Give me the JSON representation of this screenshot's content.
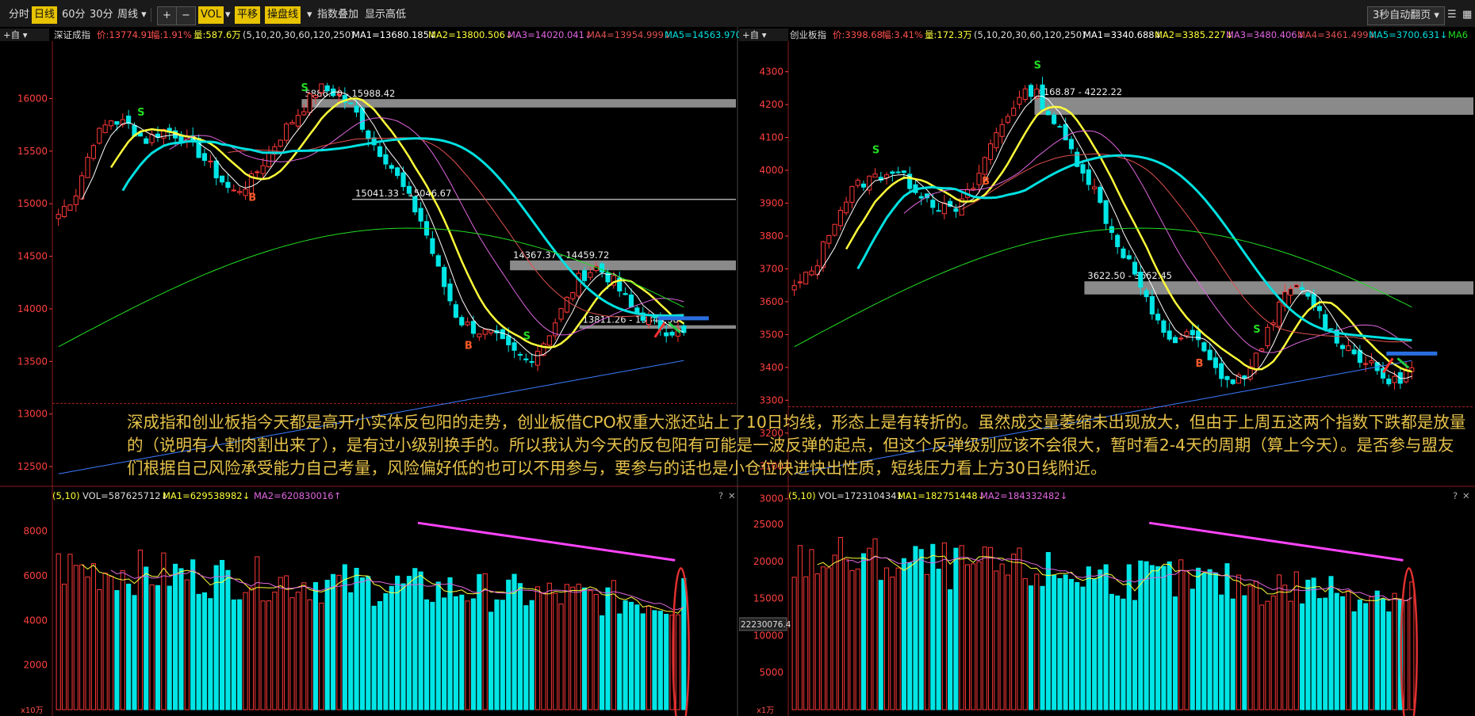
{
  "toolbar": {
    "items": [
      "分时",
      "日线",
      "60分",
      "30分",
      "周线",
      "VOL",
      "平移",
      "操盘线",
      "指数叠加",
      "显示高低"
    ],
    "right_label": "3秒自动翻页",
    "active_period": "日线"
  },
  "colors": {
    "up": "#ff3838",
    "down": "#00e5e5",
    "ma5": "#ffffff",
    "ma10": "#ffff3a",
    "ma20": "#e066e0",
    "ma30": "#e05050",
    "ma60": "#00e0e0",
    "ma120": "#22dd22",
    "ma250": "#3b7bff",
    "annotation": "#e6c24a"
  },
  "charts": [
    {
      "header": {
        "name": "深证成指",
        "price": "价:13774.91",
        "amp": "幅:1.91%",
        "amount": "量:587.6万",
        "params": "(5,10,20,30,60,120,250)",
        "ma_values": [
          "MA1=13680.185↓",
          "MA2=13800.506↓",
          "MA3=14020.041↓",
          "MA4=13954.999↓",
          "MA5=14563.970"
        ]
      },
      "y_ticks": [
        "16000",
        "15500",
        "15000",
        "14500",
        "14000",
        "13500",
        "13000",
        "12500"
      ],
      "ymin": 12350,
      "ymax": 16380,
      "zones": [
        {
          "label": "5886.70 - 15988.42",
          "low": 15915,
          "high": 15995
        },
        {
          "label": "15041.33 - 15046.67",
          "low": 15041,
          "high": 15047
        },
        {
          "label": "14367.37 - 14459.72",
          "low": 14367,
          "high": 14460
        },
        {
          "label": "13811.26 - 13843.58",
          "low": 13811,
          "high": 13844
        }
      ],
      "vol_header": {
        "params": "(5,10)",
        "vol": "VOL=587625712↓",
        "ma1": "MA1=629538982↓",
        "ma2": "MA2=620830016↑"
      },
      "vol_ticks": [
        "8000",
        "6000",
        "4000",
        "2000"
      ],
      "vol_unit": "x10万",
      "vol_max": 9300,
      "end_price": 13774.91,
      "low_price": 13100,
      "end_vol": 5876
    },
    {
      "header": {
        "name": "创业板指",
        "price": "价:3398.68",
        "amp": "幅:3.41%",
        "amount": "量:172.3万",
        "params": "(5,10,20,30,60,120,250)",
        "ma_values": [
          "MA1=3340.688↓",
          "MA2=3385.227↓",
          "MA3=3480.406↓",
          "MA4=3461.499↓",
          "MA5=3700.631↓",
          "MA6"
        ]
      },
      "y_ticks": [
        "4300",
        "4200",
        "4100",
        "4000",
        "3900",
        "3800",
        "3700",
        "3600",
        "3500",
        "3400",
        "3300",
        "3200",
        "3100",
        "3000"
      ],
      "ymin": 3050,
      "ymax": 4340,
      "zones": [
        {
          "label": "4168.87 - 4222.22",
          "low": 4169,
          "high": 4222
        },
        {
          "label": "3622.50 - 3662.45",
          "low": 3622,
          "high": 3662
        }
      ],
      "vol_header": {
        "params": "(5,10)",
        "vol": "VOL=1723104341",
        "ma1": "MA1=182751448↓",
        "ma2": "MA2=184332482↓"
      },
      "vol_ticks": [
        "25000",
        "20000",
        "15000",
        "10000",
        "5000"
      ],
      "vol_unit": "x1万",
      "vol_cursor": "22230076.4",
      "vol_max": 28000,
      "end_price": 3398.68,
      "low_price": 3280,
      "end_vol": 17231
    }
  ],
  "annotation_text": "深成指和创业板指今天都是高开小实体反包阳的走势，创业板借CPO权重大涨还站上了10日均线，形态上是有转折的。虽然成交量萎缩未出现放大，但由于上周五这两个指数下跌都是放量的（说明有人割肉割出来了），是有过小级别换手的。所以我认为今天的反包阳有可能是一波反弹的起点，但这个反弹级别应该不会很大，暂时看2-4天的周期（算上今天）。是否参与盟友们根据自己风险承受能力自己考量，风险偏好低的也可以不用参与，要参与的话也是小仓位快进快出性质，短线压力看上方30日线附近。",
  "chart_data": [
    {
      "type": "line",
      "title": "深证成指",
      "series": [
        {
          "name": "深证成指",
          "values": [
            14900,
            15100,
            15600,
            15800,
            15750,
            15600,
            15700,
            15650,
            15500,
            15300,
            15100,
            15200,
            15450,
            15700,
            15900,
            16100,
            16050,
            15900,
            15600,
            15400,
            15100,
            14800,
            14300,
            13900,
            13800,
            13750,
            13600,
            13500,
            13700,
            14000,
            14300,
            14400,
            14250,
            14000,
            13900,
            13800,
            13775
          ]
        }
      ],
      "ylim": [
        12500,
        16250
      ]
    },
    {
      "type": "line",
      "title": "创业板指",
      "series": [
        {
          "name": "创业板指",
          "values": [
            3640,
            3700,
            3850,
            3950,
            3980,
            4000,
            3950,
            3900,
            3870,
            3950,
            4100,
            4200,
            4250,
            4150,
            4050,
            3950,
            3800,
            3700,
            3550,
            3480,
            3500,
            3400,
            3350,
            3400,
            3550,
            3650,
            3600,
            3500,
            3450,
            3400,
            3350,
            3398.68
          ]
        }
      ],
      "ylim": [
        3000,
        4300
      ]
    }
  ]
}
